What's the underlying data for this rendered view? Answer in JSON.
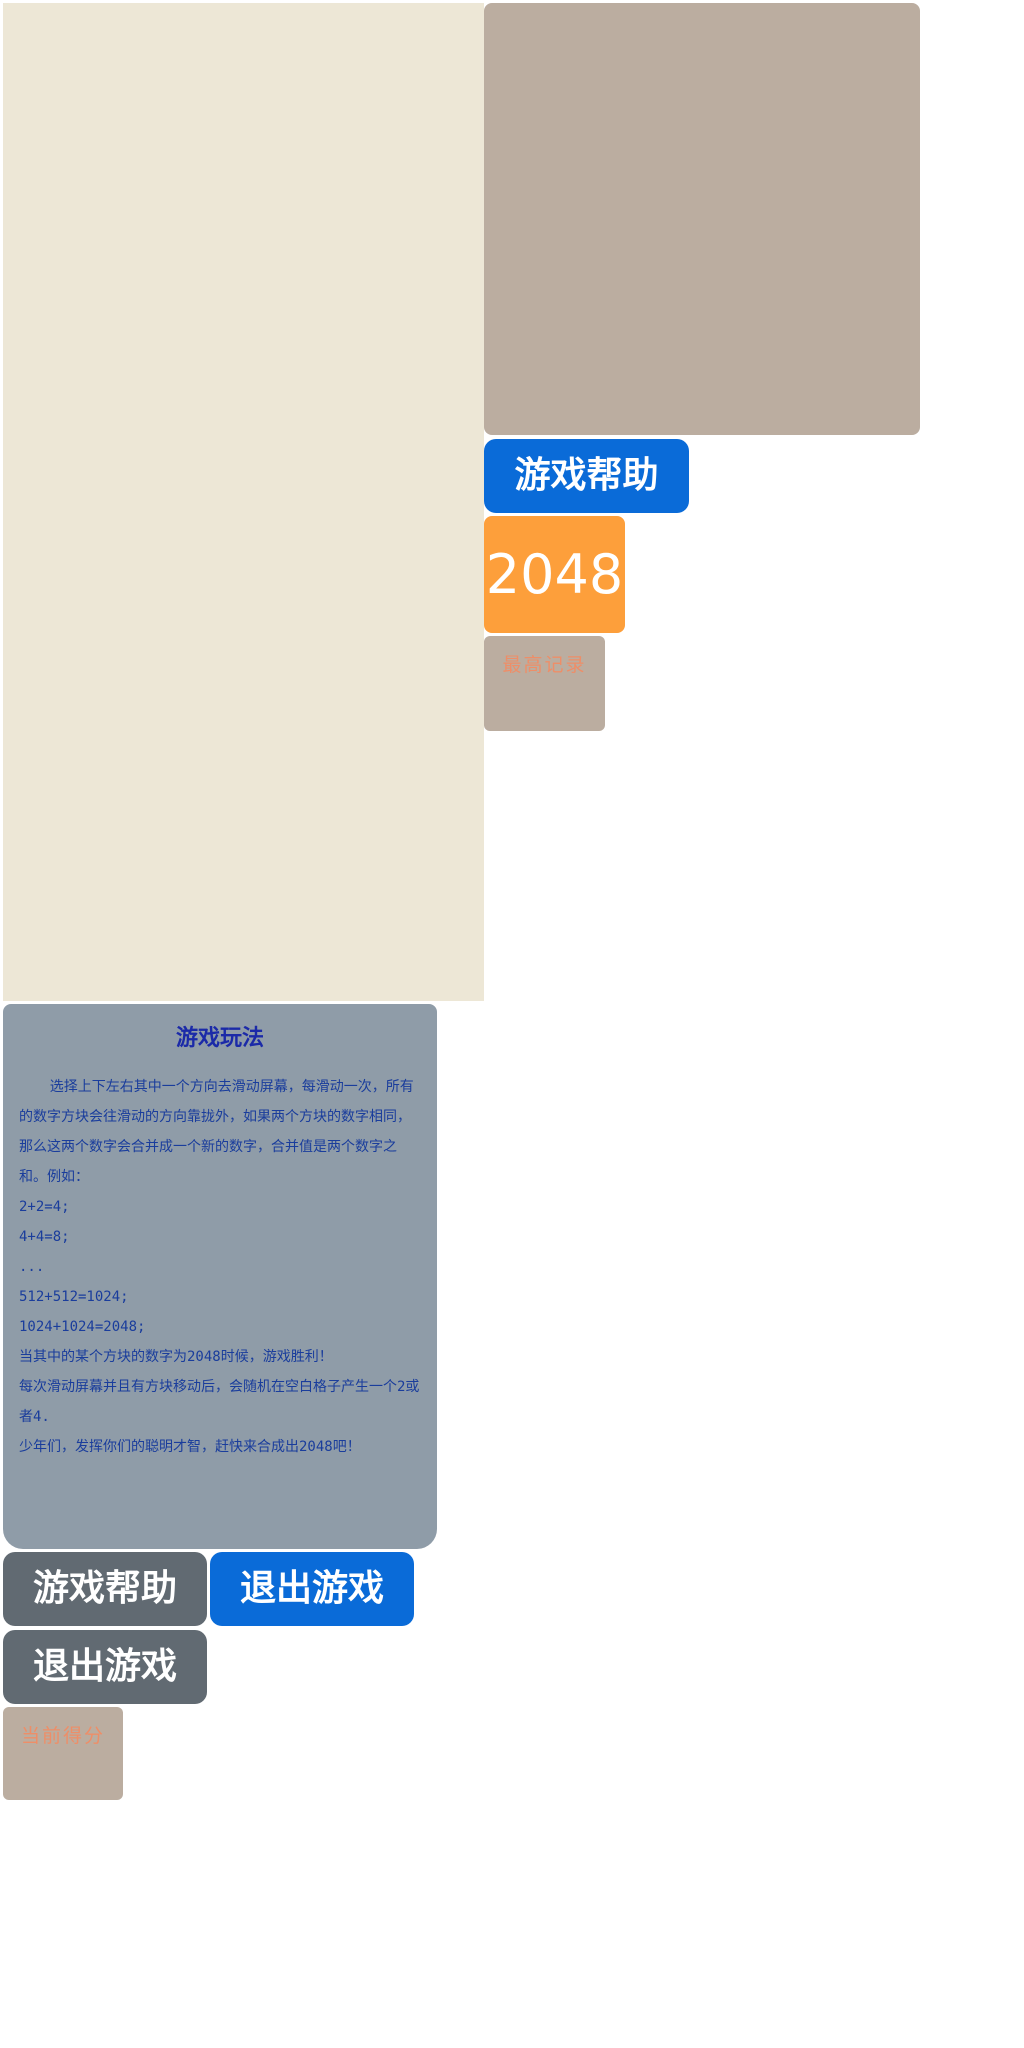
{
  "game": {
    "logo": "2048",
    "board": {
      "tiles": []
    }
  },
  "buttons": {
    "help_top": "游戏帮助",
    "help_bottom": "游戏帮助",
    "exit_blue": "退出游戏",
    "exit_gray": "退出游戏"
  },
  "scores": {
    "best_label": "最高记录",
    "best_value": "",
    "current_label": "当前得分",
    "current_value": ""
  },
  "help": {
    "title": "游戏玩法",
    "paragraphs": [
      "选择上下左右其中一个方向去滑动屏幕，每滑动一次，所有的数字方块会往滑动的方向靠拢外，如果两个方块的数字相同，那么这两个数字会合并成一个新的数字，合并值是两个数字之和。例如：",
      "2+2=4;",
      "4+4=8;",
      "...",
      "512+512=1024;",
      "1024+1024=2048;",
      "当其中的某个方块的数字为2048时候，游戏胜利！",
      "每次滑动屏幕并且有方块移动后，会随机在空白格子产生一个2或者4.",
      "少年们，发挥你们的聪明才智，赶快来合成出2048吧！"
    ]
  },
  "colors": {
    "panel_background": "#ede7d6",
    "board_background": "#bbada0",
    "logo_tile": "#fd9f3b",
    "button_blue": "#0a6bd8",
    "button_gray": "#616a72",
    "help_panel": "#8f9ca8",
    "help_text": "#1a3d9c",
    "score_label": "#ee8e68"
  }
}
